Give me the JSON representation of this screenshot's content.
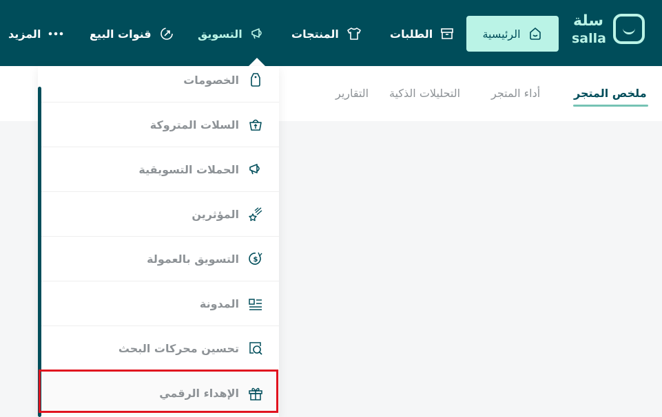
{
  "logo": {
    "arabic": "سلة",
    "latin": "salla"
  },
  "nav": {
    "home": "الرئيسية",
    "orders": "الطلبات",
    "products": "المنتجات",
    "marketing": "التسويق",
    "sales_channels": "قنوات البيع",
    "more": "المزيد"
  },
  "subtabs": {
    "summary": "ملخص المتجر",
    "performance": "أداء المتجر",
    "smart_analytics": "التحليلات الذكية",
    "reports": "التقارير"
  },
  "marketing_menu": [
    {
      "label": "الخصومات",
      "icon": "discount-tag-icon"
    },
    {
      "label": "السلات المتروكة",
      "icon": "abandoned-basket-icon"
    },
    {
      "label": "الحملات التسويقية",
      "icon": "megaphone-icon"
    },
    {
      "label": "المؤثرين",
      "icon": "shooting-star-icon"
    },
    {
      "label": "التسويق بالعمولة",
      "icon": "commission-coin-icon"
    },
    {
      "label": "المدونة",
      "icon": "blog-article-icon"
    },
    {
      "label": "تحسين محركات البحث",
      "icon": "seo-search-icon"
    },
    {
      "label": "الإهداء الرقمي",
      "icon": "gift-icon"
    }
  ],
  "colors": {
    "topbar": "#004d5a",
    "accent": "#baf3e6",
    "highlight_border": "#e1131f"
  }
}
